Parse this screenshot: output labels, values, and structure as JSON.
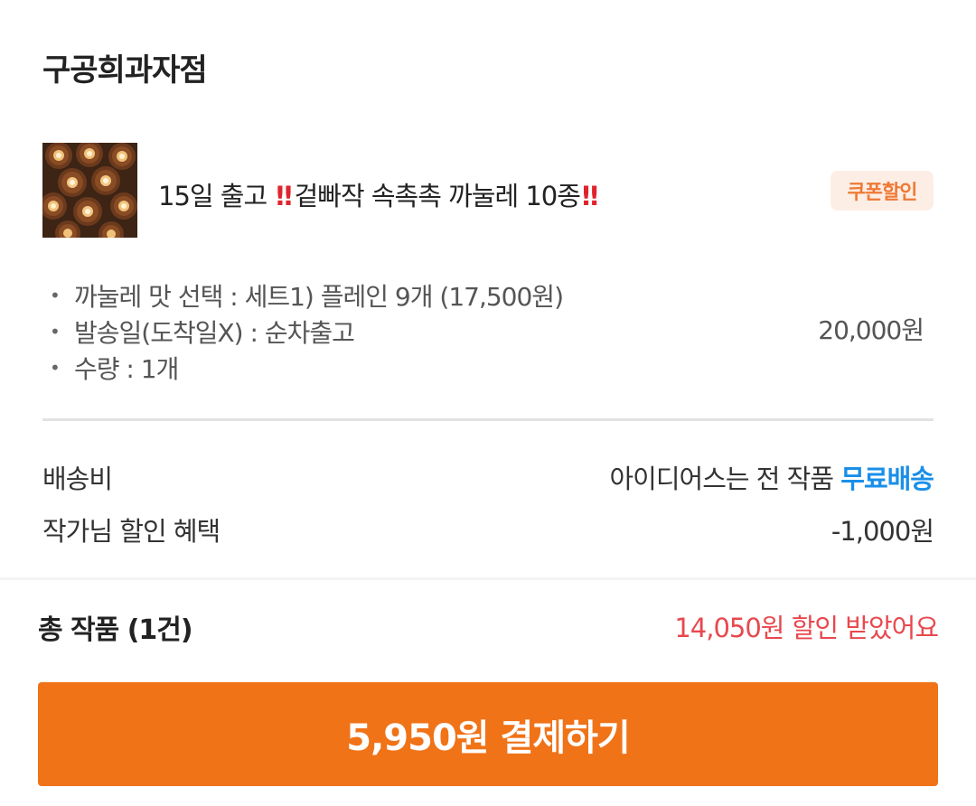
{
  "shop": {
    "name": "구공희과자점"
  },
  "product": {
    "title_parts": [
      "15일 출고",
      "‼",
      "겉빠작 속촉촉 까눌레 10종",
      "‼"
    ],
    "coupon_badge": "쿠폰할인",
    "options": [
      "까눌레 맛 선택 : 세트1) 플레인 9개 (17,500원)",
      "발송일(도착일X) : 순차출고",
      "수량 : 1개"
    ],
    "price": "20,000원",
    "thumbnail_icon": "canele-photo"
  },
  "shipping": {
    "label": "배송비",
    "value_prefix": "아이디어스는 전 작품",
    "value_highlight": "무료배송"
  },
  "artist_discount": {
    "label": "작가님 할인 혜택",
    "value": "-1,000원"
  },
  "summary": {
    "total_label": "총 작품 (1건)",
    "discount_message": "14,050원 할인 받았어요"
  },
  "checkout": {
    "button_label": "5,950원 결제하기"
  },
  "colors": {
    "accent_orange": "#f07318",
    "free_shipping_blue": "#1a8fe8",
    "discount_red": "#e8484e",
    "coupon_text": "#ee7a36",
    "coupon_bg": "#fdeee5"
  }
}
